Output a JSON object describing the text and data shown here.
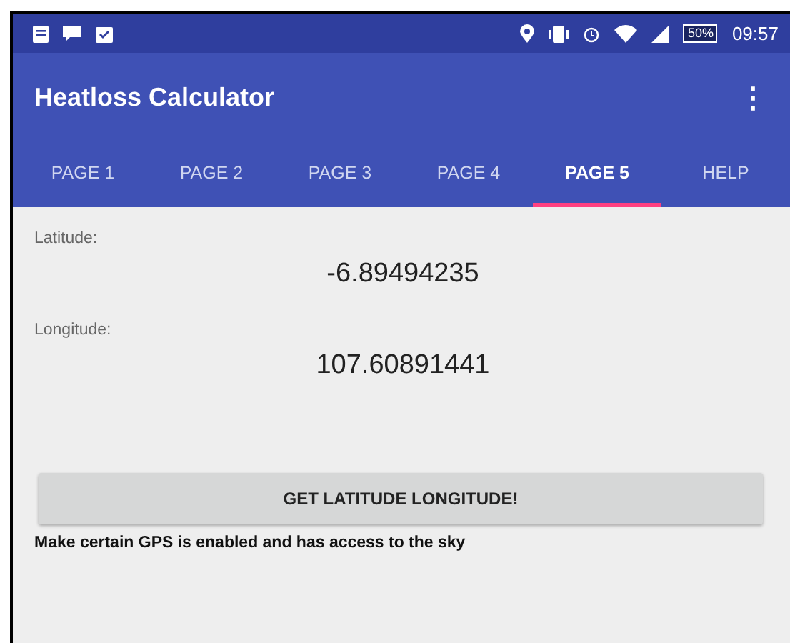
{
  "status_bar": {
    "battery": "50%",
    "time": "09:57"
  },
  "app_bar": {
    "title": "Heatloss Calculator",
    "menu": "⋮"
  },
  "tabs": [
    {
      "label": "PAGE 1",
      "selected": false
    },
    {
      "label": "PAGE 2",
      "selected": false
    },
    {
      "label": "PAGE 3",
      "selected": false
    },
    {
      "label": "PAGE 4",
      "selected": false
    },
    {
      "label": "PAGE 5",
      "selected": true
    },
    {
      "label": "HELP",
      "selected": false
    }
  ],
  "fields": [
    {
      "label": "Latitude:",
      "value": "-6.89494235"
    },
    {
      "label": "Longitude:",
      "value": "107.60891441"
    }
  ],
  "button": "GET LATITUDE LONGITUDE!",
  "note": "Make certain GPS is enabled and has access to the sky"
}
